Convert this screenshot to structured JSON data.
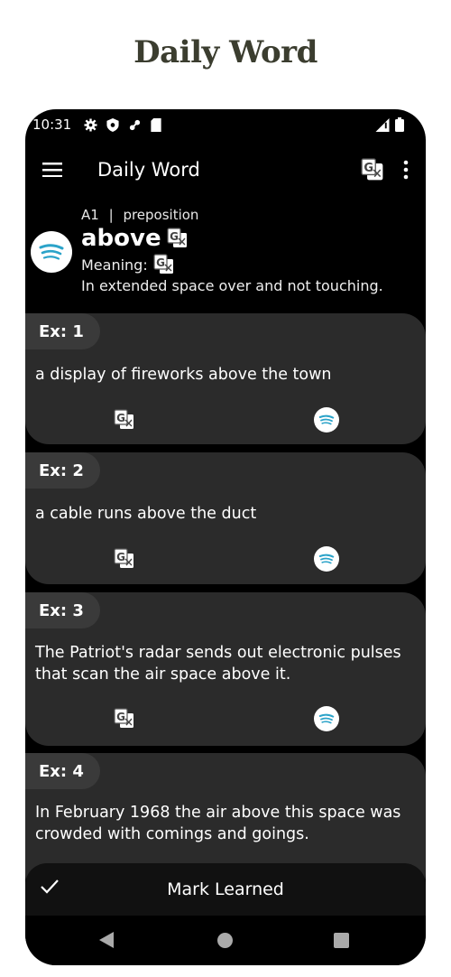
{
  "promo": {
    "title": "Daily Word"
  },
  "status_bar": {
    "time": "10:31"
  },
  "app_bar": {
    "title": "Daily Word"
  },
  "word": {
    "level": "A1",
    "separator": "|",
    "part_of_speech": "preposition",
    "text": "above",
    "meaning_label": "Meaning:",
    "definition": "In extended space over and not touching."
  },
  "examples": [
    {
      "label": "Ex: 1",
      "text": "a display of fireworks above the town"
    },
    {
      "label": "Ex: 2",
      "text": "a cable runs above the duct"
    },
    {
      "label": "Ex: 3",
      "text": "The Patriot's radar sends out electronic pulses that scan the air space above it."
    },
    {
      "label": "Ex: 4",
      "text": "In February 1968 the air above this space was crowded with comings and goings."
    }
  ],
  "bottom_action": {
    "label": "Mark Learned"
  },
  "colors": {
    "background": "#000000",
    "card": "#2b2b2b",
    "chip": "#3a3a3a",
    "spotify_accent": "#2ba3c9"
  }
}
